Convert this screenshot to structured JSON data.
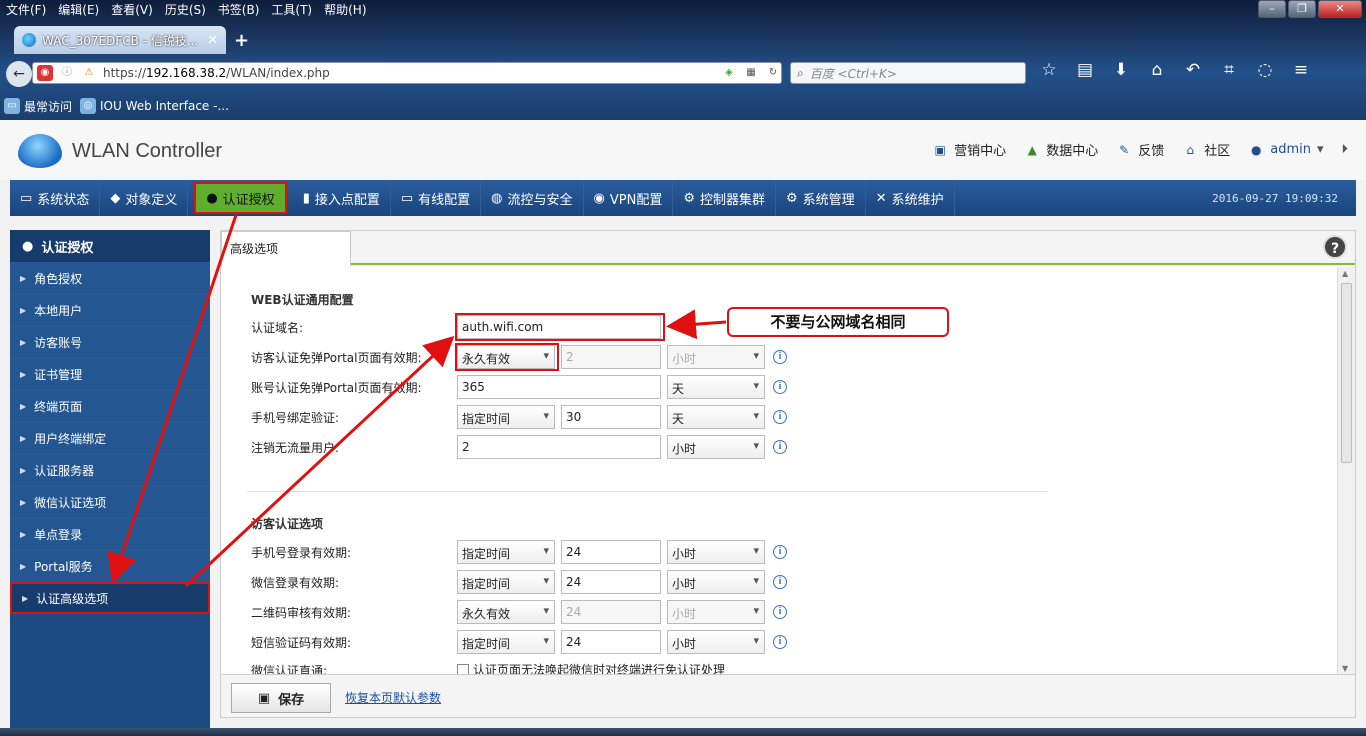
{
  "browser": {
    "menu": [
      "文件(F)",
      "编辑(E)",
      "查看(V)",
      "历史(S)",
      "书签(B)",
      "工具(T)",
      "帮助(H)"
    ],
    "tab_title": "WAC_307EDFCB - 信锐技...",
    "url_prefix": "https://",
    "url_host": "192.168.38.2",
    "url_path": "/WLAN/index.php",
    "search_placeholder": "百度 <Ctrl+K>",
    "bookmarks": [
      "最常访问",
      "IOU Web Interface -..."
    ]
  },
  "app": {
    "logo_text": "WLAN Controller",
    "header_links": [
      "营销中心",
      "数据中心",
      "反馈",
      "社区"
    ],
    "user": "admin",
    "nav": [
      {
        "label": "系统状态",
        "icon": "monitor-icon"
      },
      {
        "label": "对象定义",
        "icon": "cube-icon"
      },
      {
        "label": "认证授权",
        "icon": "user-icon"
      },
      {
        "label": "接入点配置",
        "icon": "signal-icon"
      },
      {
        "label": "有线配置",
        "icon": "switch-icon"
      },
      {
        "label": "流控与安全",
        "icon": "globe-icon"
      },
      {
        "label": "VPN配置",
        "icon": "vpn-icon"
      },
      {
        "label": "控制器集群",
        "icon": "gear-icon"
      },
      {
        "label": "系统管理",
        "icon": "gear-icon"
      },
      {
        "label": "系统维护",
        "icon": "tools-icon"
      }
    ],
    "datetime": "2016-09-27 19:09:32",
    "sidebar": {
      "title": "认证授权",
      "items": [
        "角色授权",
        "本地用户",
        "访客账号",
        "证书管理",
        "终端页面",
        "用户终端绑定",
        "认证服务器",
        "微信认证选项",
        "单点登录",
        "Portal服务",
        "认证高级选项"
      ]
    },
    "tab": "高级选项",
    "section1": {
      "title": "WEB认证通用配置",
      "rows": [
        {
          "label": "认证域名:",
          "value": "auth.wifi.com"
        },
        {
          "label": "访客认证免弹Portal页面有效期:",
          "mode": "永久有效",
          "num": "2",
          "unit": "小时"
        },
        {
          "label": "账号认证免弹Portal页面有效期:",
          "num": "365",
          "unit": "天"
        },
        {
          "label": "手机号绑定验证:",
          "mode": "指定时间",
          "num": "30",
          "unit": "天"
        },
        {
          "label": "注销无流量用户:",
          "num": "2",
          "unit": "小时"
        }
      ]
    },
    "section2": {
      "title": "访客认证选项",
      "rows": [
        {
          "label": "手机号登录有效期:",
          "mode": "指定时间",
          "num": "24",
          "unit": "小时"
        },
        {
          "label": "微信登录有效期:",
          "mode": "指定时间",
          "num": "24",
          "unit": "小时"
        },
        {
          "label": "二维码审核有效期:",
          "mode": "永久有效",
          "num": "24",
          "unit": "小时"
        },
        {
          "label": "短信验证码有效期:",
          "mode": "指定时间",
          "num": "24",
          "unit": "小时"
        },
        {
          "label": "微信认证直通:",
          "check_label": "认证页面无法唤起微信时对终端进行免认证处理"
        }
      ]
    },
    "callout": "不要与公网域名相同",
    "save": "保存",
    "restore": "恢复本页默认参数"
  }
}
